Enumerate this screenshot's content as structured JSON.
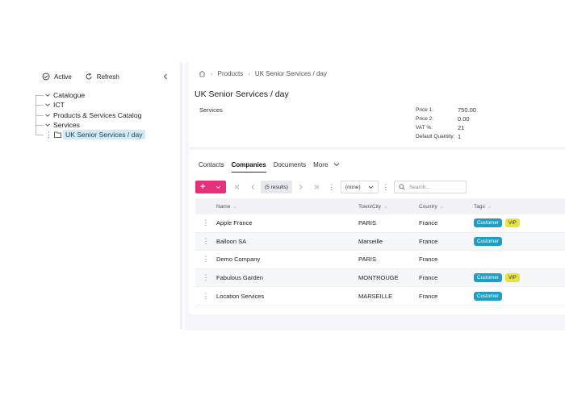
{
  "sidebar": {
    "active_label": "Active",
    "refresh_label": "Refresh",
    "tree": [
      {
        "label": "Catalogue"
      },
      {
        "label": "ICT"
      },
      {
        "label": "Products & Services Catalog"
      },
      {
        "label": "Services"
      },
      {
        "label": "UK Senior Services / day",
        "selected": true
      }
    ]
  },
  "breadcrumb": {
    "items": [
      "Products",
      "UK Senior Services / day"
    ]
  },
  "record": {
    "title": "UK Senior Services / day",
    "category": "Services",
    "prices": [
      {
        "key": "Price 1:",
        "value": "750.00"
      },
      {
        "key": "Price 2:",
        "value": "0.00"
      },
      {
        "key": "VAT %:",
        "value": "21"
      },
      {
        "key": "Default Quantity:",
        "value": "1"
      }
    ]
  },
  "tabs": {
    "contacts": "Contacts",
    "companies": "Companies",
    "documents": "Documents",
    "more": "More"
  },
  "toolbar": {
    "results": "(5 results)",
    "filter_value": "(none)",
    "search_placeholder": "Search..."
  },
  "table": {
    "headers": {
      "name": "Name",
      "town": "Town/City",
      "country": "Country",
      "tags": "Tags"
    },
    "rows": [
      {
        "name": "Apple France",
        "town": "PARIS",
        "country": "France",
        "tags": [
          "Customer",
          "VIP"
        ]
      },
      {
        "name": "Balloon SA",
        "town": "Marseille",
        "country": "France",
        "tags": [
          "Customer"
        ]
      },
      {
        "name": "Demo Company",
        "town": "PARIS",
        "country": "France",
        "tags": []
      },
      {
        "name": "Fabulous Garden",
        "town": "MONTROUGE",
        "country": "France",
        "tags": [
          "Customer",
          "VIP"
        ]
      },
      {
        "name": "Location Services",
        "town": "MARSEILLE",
        "country": "France",
        "tags": [
          "Customer"
        ]
      }
    ]
  },
  "colors": {
    "accent": "#e8307a",
    "customer_badge": "#1c9fc6",
    "vip_badge": "#e9e23a",
    "selected_bg": "#d2eaf8"
  }
}
